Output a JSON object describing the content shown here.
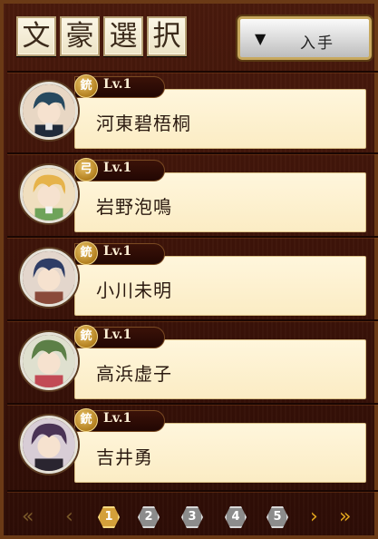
{
  "header": {
    "title_chars": [
      "文",
      "豪",
      "選",
      "択"
    ],
    "get_button": {
      "arrow": "▼",
      "label": "入手"
    }
  },
  "authors": [
    {
      "name": "河東碧梧桐",
      "level": "Lv.1",
      "weapon": "銃"
    },
    {
      "name": "岩野泡鳴",
      "level": "Lv.1",
      "weapon": "弓"
    },
    {
      "name": "小川未明",
      "level": "Lv.1",
      "weapon": "銃"
    },
    {
      "name": "高浜虚子",
      "level": "Lv.1",
      "weapon": "銃"
    },
    {
      "name": "吉井勇",
      "level": "Lv.1",
      "weapon": "銃"
    }
  ],
  "pagination": {
    "first": "«",
    "prev": "‹",
    "next": "›",
    "last": "»",
    "pages": [
      "1",
      "2",
      "3",
      "4",
      "5"
    ],
    "current": "1"
  },
  "colors": {
    "background": "#3a1208",
    "card": "#fbecc4",
    "accent_gold": "#d4a03a"
  }
}
